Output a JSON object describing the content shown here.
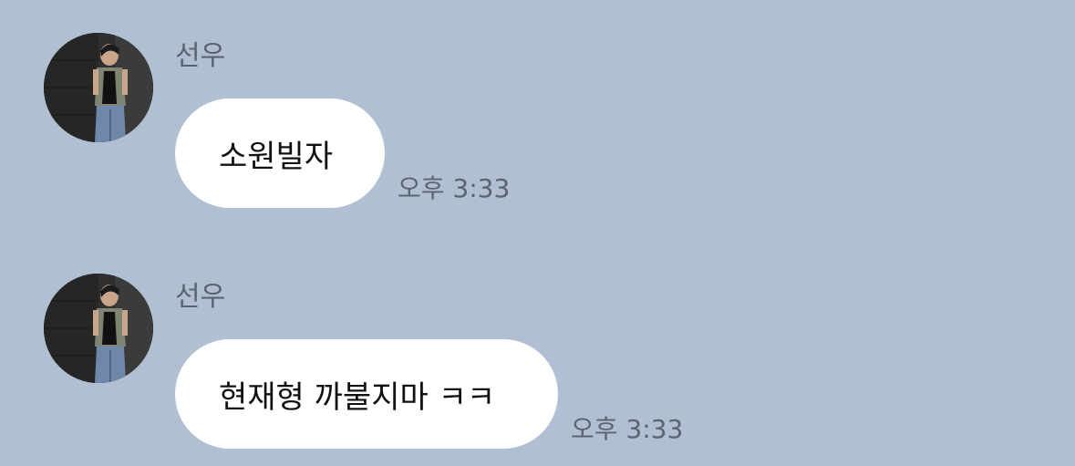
{
  "chat": {
    "messages": [
      {
        "sender": "선우",
        "text": "소원빌자",
        "time": "오후 3:33",
        "avatar_icon": "user-photo-avatar"
      },
      {
        "sender": "선우",
        "text": "현재형 까불지마 ㅋㅋ",
        "time": "오후 3:33",
        "avatar_icon": "user-photo-avatar"
      }
    ]
  },
  "colors": {
    "background": "#b0bfd1",
    "bubble": "#ffffff",
    "meta_text": "#5b6470",
    "message_text": "#111111"
  }
}
